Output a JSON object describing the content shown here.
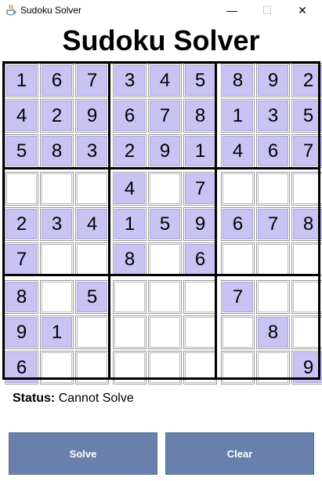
{
  "window": {
    "title": "Sudoku Solver",
    "minimize_glyph": "—",
    "maximize_glyph": "☐",
    "close_glyph": "✕"
  },
  "heading": "Sudoku Solver",
  "board": {
    "rows": [
      [
        "1",
        "6",
        "7",
        "3",
        "4",
        "5",
        "8",
        "9",
        "2"
      ],
      [
        "4",
        "2",
        "9",
        "6",
        "7",
        "8",
        "1",
        "3",
        "5"
      ],
      [
        "5",
        "8",
        "3",
        "2",
        "9",
        "1",
        "4",
        "6",
        "7"
      ],
      [
        "",
        "",
        "",
        "4",
        "",
        "7",
        "",
        "",
        ""
      ],
      [
        "2",
        "3",
        "4",
        "1",
        "5",
        "9",
        "6",
        "7",
        "8"
      ],
      [
        "7",
        "",
        "",
        "8",
        "",
        "6",
        "",
        "",
        ""
      ],
      [
        "8",
        "",
        "5",
        "",
        "",
        "",
        "7",
        "",
        ""
      ],
      [
        "9",
        "1",
        "",
        "",
        "",
        "",
        "",
        "8",
        ""
      ],
      [
        "6",
        "",
        "",
        "",
        "",
        "",
        "",
        "",
        "9"
      ]
    ],
    "filled_color": "#c8c3f3",
    "empty_color": "#ffffff"
  },
  "status": {
    "label": "Status:",
    "value": "Cannot Solve"
  },
  "buttons": {
    "solve": "Solve",
    "clear": "Clear",
    "color": "#6980ad"
  }
}
